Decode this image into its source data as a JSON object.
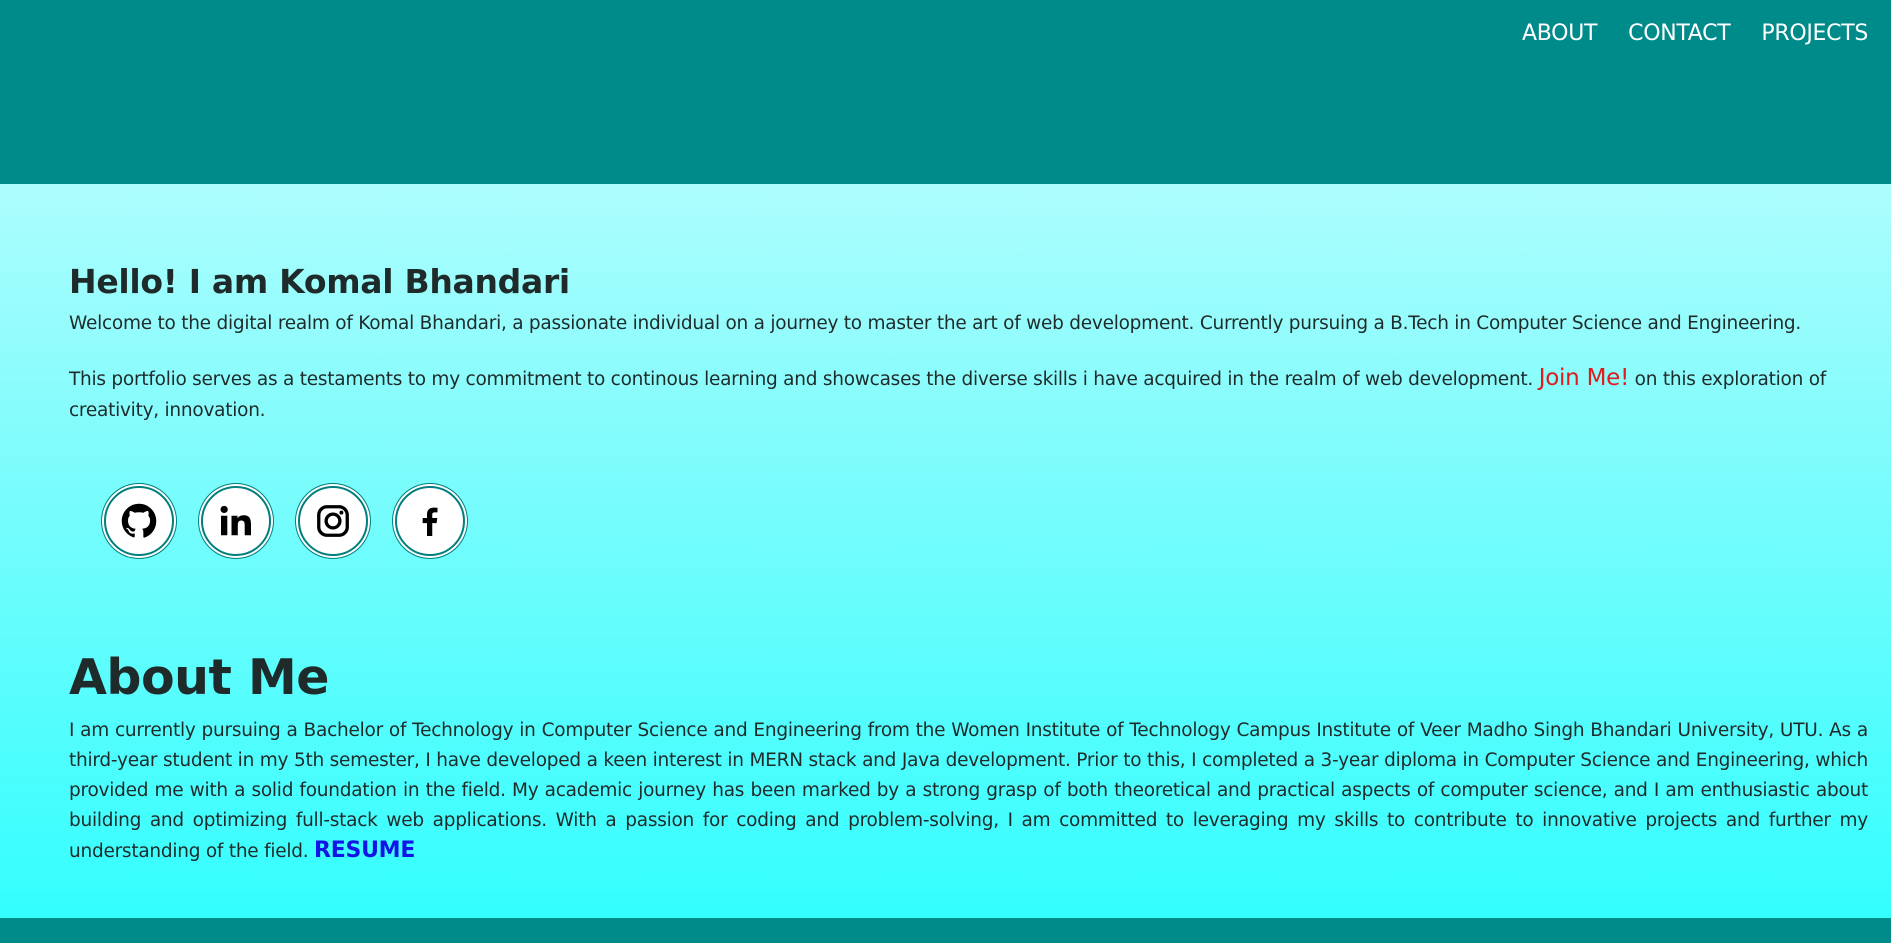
{
  "nav": {
    "items": [
      "ABOUT",
      "CONTACT",
      "PROJECTS"
    ]
  },
  "intro": {
    "greeting": "Hello! I am Komal Bhandari",
    "p1": "Welcome to the digital realm of Komal Bhandari, a passionate individual on a journey to master the art of web development. Currently pursuing a B.Tech in Computer Science and Engineering.",
    "p2_before": "This portfolio serves as a testaments to my commitment to continous learning and showcases the diverse skills i have acquired in the realm of web development. ",
    "join_link": "Join Me!",
    "p2_after": " on this exploration of creativity, innovation."
  },
  "social": {
    "icons": [
      "github-icon",
      "linkedin-icon",
      "instagram-icon",
      "facebook-icon"
    ]
  },
  "about": {
    "heading": "About Me",
    "body": "I am currently pursuing a Bachelor of Technology in Computer Science and Engineering from the Women Institute of Technology Campus Institute of Veer Madho Singh Bhandari University, UTU. As a third-year student in my 5th semester, I have developed a keen interest in MERN stack and Java development. Prior to this, I completed a 3-year diploma in Computer Science and Engineering, which provided me with a solid foundation in the field. My academic journey has been marked by a strong grasp of both theoretical and practical aspects of computer science, and I am enthusiastic about building and optimizing full-stack web applications. With a passion for coding and problem-solving, I am committed to leveraging my skills to contribute to innovative projects and further my understanding of the field. ",
    "resume_link": "RESUME"
  },
  "colors": {
    "header_bg": "#008b8b",
    "join_link": "#e01b1b",
    "resume_link": "#1414e6",
    "gradient_top": "#ccffff",
    "gradient_bottom": "#2ffefe"
  }
}
